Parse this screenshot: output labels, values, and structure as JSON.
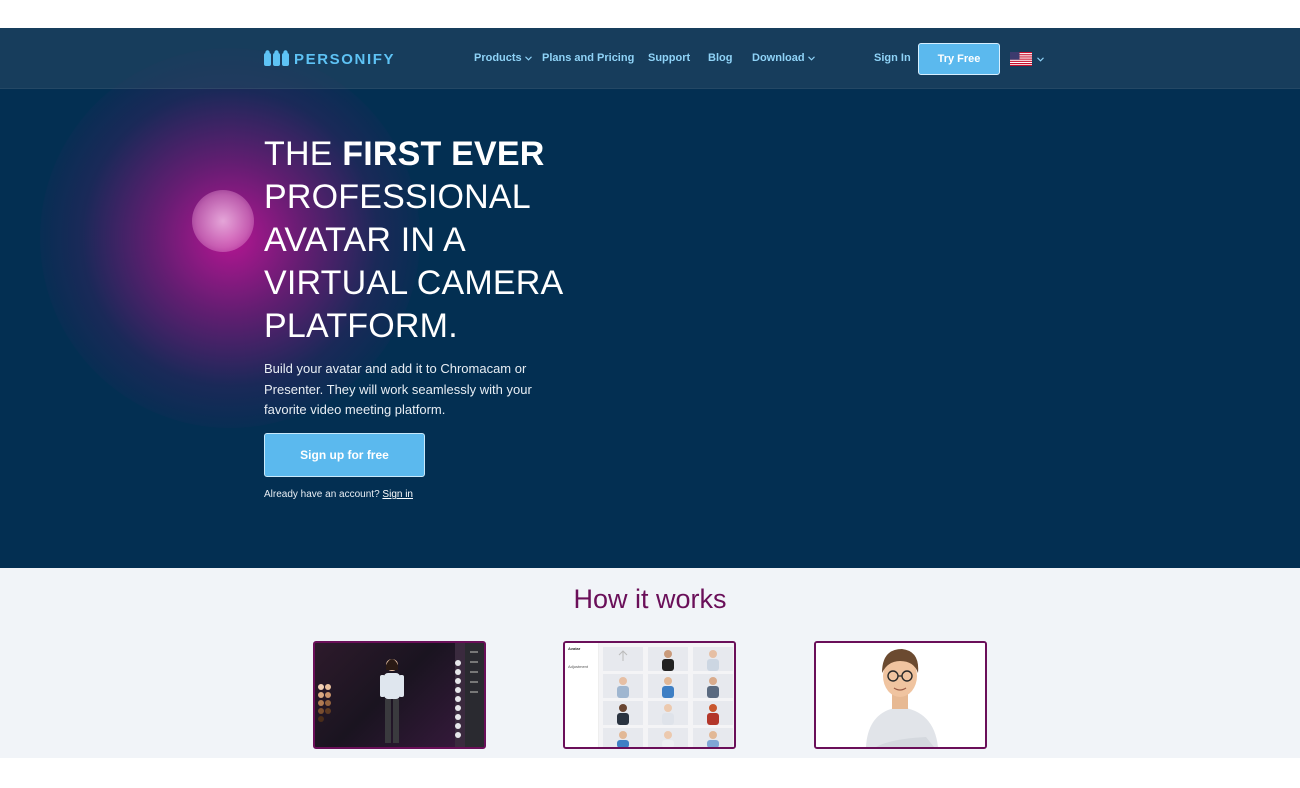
{
  "brand": {
    "name": "PERSONIFY",
    "color": "#5ec3f5"
  },
  "nav": {
    "products": "Products",
    "plans": "Plans and Pricing",
    "support": "Support",
    "blog": "Blog",
    "download": "Download",
    "sign_in": "Sign In",
    "try_free": "Try Free",
    "language_flag": "us-flag-icon"
  },
  "hero": {
    "headline_part1": "THE ",
    "headline_strong": "FIRST EVER",
    "headline_part2": "PROFESSIONAL AVATAR IN A VIRTUAL CAMERA PLATFORM.",
    "subtext": "Build your avatar and add it to Chromacam or Presenter. They will work seamlessly with your favorite video meeting platform.",
    "signup_button": "Sign up for free",
    "already_text": "Already have an account? ",
    "signin_link": "Sign in"
  },
  "how_it_works": {
    "title": "How it works",
    "card2_menu_title": "Avatar",
    "card2_menu_item": "Adjustment"
  },
  "colors": {
    "hero_bg": "#032f52",
    "accent_blue": "#5bb9ee",
    "accent_purple": "#6a0f59",
    "section_bg": "#f1f4f8"
  }
}
